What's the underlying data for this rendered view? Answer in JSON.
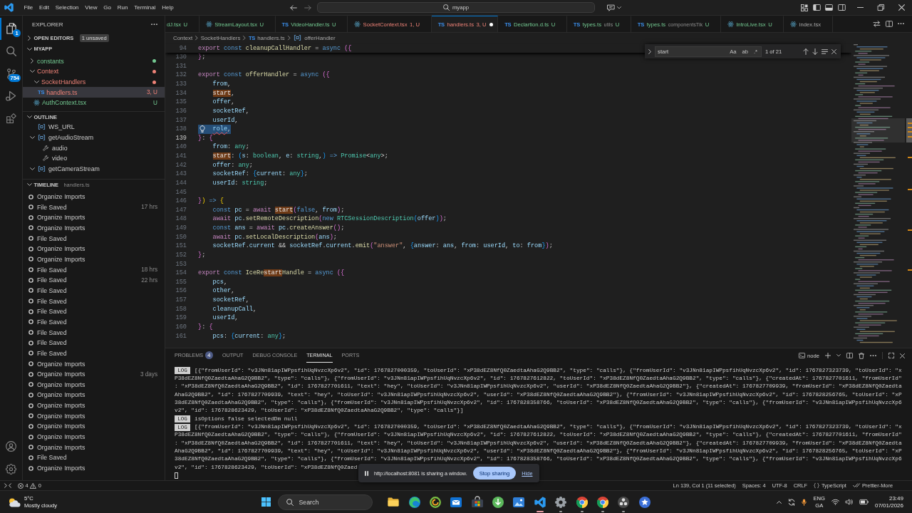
{
  "title_bar": {
    "menu": [
      "File",
      "Edit",
      "Selection",
      "View",
      "Go",
      "Run",
      "Terminal",
      "Help"
    ],
    "command_center": "myapp"
  },
  "activity_bar": {
    "items": [
      {
        "kind": "files",
        "selected": true,
        "badge": "1"
      },
      {
        "kind": "search",
        "selected": false
      },
      {
        "kind": "branch",
        "selected": false,
        "badge": "754"
      },
      {
        "kind": "play",
        "selected": false
      },
      {
        "kind": "blocks",
        "selected": false
      }
    ]
  },
  "sidebar": {
    "title": "EXPLORER",
    "open_editors": {
      "label": "OPEN EDITORS",
      "expanded": false,
      "badge": "1 unsaved"
    },
    "project": {
      "label": "MYAPP",
      "expanded": true,
      "items": [
        {
          "kind": "folder",
          "label": "constants",
          "expanded": false,
          "selected": false,
          "problems": false
        },
        {
          "kind": "folder",
          "label": "Context",
          "expanded": true,
          "selected": false,
          "problems": true,
          "children": [
            {
              "kind": "folder",
              "label": "SocketHandlers",
              "expanded": true,
              "selected": false,
              "problems": true,
              "children": [
                {
                  "kind": "ts",
                  "icon": "TS",
                  "label": "handlers.ts",
                  "status": "3, U",
                  "selected": true,
                  "problems": true
                }
              ]
            },
            {
              "kind": "react",
              "label": "AuthContext.tsx",
              "status": "U",
              "selected": false,
              "problems": false
            }
          ]
        }
      ]
    },
    "outline": {
      "label": "OUTLINE",
      "expanded": true,
      "items": [
        {
          "kind": "symbol",
          "label": "WS_URL"
        },
        {
          "kind": "symbol",
          "label": "getAudioStream",
          "expanded": true,
          "children": [
            {
              "kind": "property",
              "label": "audio"
            },
            {
              "kind": "property",
              "label": "video"
            }
          ]
        },
        {
          "kind": "symbol",
          "label": "getCameraStream",
          "expanded": true
        }
      ]
    },
    "timeline": {
      "label": "TIMELINE",
      "file": "handlers.ts",
      "expanded": true,
      "items": [
        {
          "label": "Organize Imports"
        },
        {
          "label": "File Saved",
          "time": "17 hrs"
        },
        {
          "label": "Organize Imports"
        },
        {
          "label": "Organize Imports"
        },
        {
          "label": "File Saved"
        },
        {
          "label": "Organize Imports"
        },
        {
          "label": "Organize Imports"
        },
        {
          "label": "File Saved",
          "time": "18 hrs"
        },
        {
          "label": "File Saved",
          "time": "22 hrs"
        },
        {
          "label": "File Saved"
        },
        {
          "label": "File Saved"
        },
        {
          "label": "File Saved"
        },
        {
          "label": "File Saved"
        },
        {
          "label": "File Saved"
        },
        {
          "label": "File Saved"
        },
        {
          "label": "File Saved"
        },
        {
          "label": "Organize Imports"
        },
        {
          "label": "Organize Imports",
          "time": "3 days"
        },
        {
          "label": "Organize Imports"
        },
        {
          "label": "Organize Imports"
        },
        {
          "label": "Organize Imports"
        },
        {
          "label": "Organize Imports"
        },
        {
          "label": "Organize Imports"
        },
        {
          "label": "Organize Imports"
        },
        {
          "label": "Organize Imports"
        },
        {
          "label": "File Saved"
        },
        {
          "label": "Organize Imports"
        }
      ]
    }
  },
  "tabs": [
    {
      "label": "dJ.tsx",
      "status": "U",
      "problems": false,
      "selected": false,
      "dirty": false
    },
    {
      "kind": "react",
      "label": "StreamLayout.tsx",
      "status": "U",
      "problems": false,
      "selected": false,
      "dirty": false
    },
    {
      "kind": "ts",
      "icon": "TS",
      "label": "VideoHandler.ts",
      "status": "U",
      "problems": false,
      "selected": false,
      "dirty": false
    },
    {
      "kind": "react",
      "label": "SocketContext.tsx",
      "status": "1, U",
      "problems": true,
      "selected": false,
      "dirty": false
    },
    {
      "kind": "ts",
      "icon": "TS",
      "label": "handlers.ts",
      "status": "3, U",
      "problems": true,
      "selected": true,
      "dirty": true
    },
    {
      "kind": "ts",
      "icon": "TS",
      "label": "Declartion.d.ts",
      "status": "U",
      "problems": false,
      "selected": false,
      "dirty": false
    },
    {
      "kind": "ts",
      "icon": "TS",
      "label": "types.ts",
      "description": "utils",
      "status": "U",
      "problems": false,
      "selected": false,
      "dirty": false
    },
    {
      "kind": "ts",
      "icon": "TS",
      "label": "types.ts",
      "description": "componentsTik",
      "status": "U",
      "problems": false,
      "selected": false,
      "dirty": false
    },
    {
      "kind": "react",
      "label": "IntroLive.tsx",
      "status": "U",
      "problems": false,
      "selected": false,
      "dirty": false
    },
    {
      "kind": "react",
      "label": "index.tsx",
      "problems": false,
      "selected": false,
      "dirty": false
    }
  ],
  "breadcrumbs": [
    {
      "kind": "folder",
      "label": "Context"
    },
    {
      "kind": "folder",
      "label": "SocketHandlers"
    },
    {
      "kind": "ts",
      "icon": "TS",
      "label": "handlers.ts"
    },
    {
      "kind": "symbol",
      "label": "offerHandler"
    }
  ],
  "editor": {
    "sticky": {
      "number": "94",
      "tokens": [
        {
          "kind": "control",
          "text": "export "
        },
        {
          "kind": "keyword",
          "text": "const "
        },
        {
          "kind": "function",
          "text": "cleanupCallHandler"
        },
        {
          "kind": "plain",
          "text": " = "
        },
        {
          "kind": "keyword",
          "text": "async "
        },
        {
          "kind": "bracket2",
          "text": "({"
        }
      ]
    },
    "lines": [
      {
        "number": "130",
        "active": false,
        "selected": false,
        "tokens": [
          {
            "kind": "bracket2",
            "text": "}"
          },
          {
            "kind": "plain",
            "text": ";"
          }
        ]
      },
      {
        "number": "131",
        "active": false,
        "selected": false
      },
      {
        "number": "132",
        "active": false,
        "selected": false,
        "tokens": [
          {
            "kind": "control",
            "text": "export "
          },
          {
            "kind": "keyword",
            "text": "const "
          },
          {
            "kind": "function",
            "text": "offerHandler"
          },
          {
            "kind": "plain",
            "text": " = "
          },
          {
            "kind": "keyword",
            "text": "async "
          },
          {
            "kind": "bracket2",
            "text": "({"
          }
        ]
      },
      {
        "number": "133",
        "active": false,
        "selected": false,
        "tokens": [
          {
            "kind": "variable",
            "text": "    from"
          },
          {
            "kind": "plain",
            "text": ","
          }
        ]
      },
      {
        "number": "134",
        "active": false,
        "selected": false,
        "tokens": [
          {
            "kind": "match",
            "text": "    start"
          },
          {
            "kind": "plain",
            "text": ","
          }
        ]
      },
      {
        "number": "135",
        "active": false,
        "selected": false,
        "tokens": [
          {
            "kind": "variable",
            "text": "    offer"
          },
          {
            "kind": "plain",
            "text": ","
          }
        ]
      },
      {
        "number": "136",
        "active": false,
        "selected": false,
        "tokens": [
          {
            "kind": "variable",
            "text": "    socketRef"
          },
          {
            "kind": "plain",
            "text": ","
          }
        ]
      },
      {
        "number": "137",
        "active": false,
        "selected": false,
        "tokens": [
          {
            "kind": "variable",
            "text": "    userId"
          },
          {
            "kind": "plain",
            "text": ","
          }
        ]
      },
      {
        "number": "138",
        "active": false,
        "selected": true,
        "tokens": [
          {
            "kind": "error",
            "text": "    role"
          },
          {
            "kind": "plain",
            "text": ","
          }
        ]
      },
      {
        "number": "139",
        "active": true,
        "selected": false,
        "tokens": [
          {
            "kind": "bracket2",
            "text": "}"
          },
          {
            "kind": "plain",
            "text": ": "
          },
          {
            "kind": "bracket2",
            "text": "{"
          }
        ]
      },
      {
        "number": "140",
        "active": false,
        "selected": false,
        "tokens": [
          {
            "kind": "variable",
            "text": "    from"
          },
          {
            "kind": "plain",
            "text": ": "
          },
          {
            "kind": "type",
            "text": "any"
          },
          {
            "kind": "plain",
            "text": ";"
          }
        ]
      },
      {
        "number": "141",
        "active": false,
        "selected": false,
        "tokens": [
          {
            "kind": "match",
            "text": "    start"
          },
          {
            "kind": "plain",
            "text": ": "
          },
          {
            "kind": "bracket3",
            "text": "("
          },
          {
            "kind": "variable",
            "text": "s"
          },
          {
            "kind": "plain",
            "text": ": "
          },
          {
            "kind": "type",
            "text": "boolean"
          },
          {
            "kind": "plain",
            "text": ", "
          },
          {
            "kind": "variable",
            "text": "e"
          },
          {
            "kind": "plain",
            "text": ": "
          },
          {
            "kind": "type",
            "text": "string"
          },
          {
            "kind": "plain",
            "text": ","
          },
          {
            "kind": "bracket3",
            "text": ")"
          },
          {
            "kind": "keyword",
            "text": " => "
          },
          {
            "kind": "type",
            "text": "Promise"
          },
          {
            "kind": "plain",
            "text": "<"
          },
          {
            "kind": "type",
            "text": "any"
          },
          {
            "kind": "plain",
            "text": ">;"
          }
        ]
      },
      {
        "number": "142",
        "active": false,
        "selected": false,
        "tokens": [
          {
            "kind": "variable",
            "text": "    offer"
          },
          {
            "kind": "plain",
            "text": ": "
          },
          {
            "kind": "type",
            "text": "any"
          },
          {
            "kind": "plain",
            "text": ";"
          }
        ]
      },
      {
        "number": "143",
        "active": false,
        "selected": false,
        "tokens": [
          {
            "kind": "variable",
            "text": "    socketRef"
          },
          {
            "kind": "plain",
            "text": ": "
          },
          {
            "kind": "bracket3",
            "text": "{"
          },
          {
            "kind": "variable",
            "text": "current"
          },
          {
            "kind": "plain",
            "text": ": "
          },
          {
            "kind": "type",
            "text": "any"
          },
          {
            "kind": "bracket3",
            "text": "}"
          },
          {
            "kind": "plain",
            "text": ";"
          }
        ]
      },
      {
        "number": "144",
        "active": false,
        "selected": false,
        "tokens": [
          {
            "kind": "variable",
            "text": "    userId"
          },
          {
            "kind": "plain",
            "text": ": "
          },
          {
            "kind": "type",
            "text": "string"
          },
          {
            "kind": "plain",
            "text": ";"
          }
        ]
      },
      {
        "number": "145",
        "active": false,
        "selected": false
      },
      {
        "number": "146",
        "active": false,
        "selected": false,
        "tokens": [
          {
            "kind": "bracket2",
            "text": "}"
          },
          {
            "kind": "bracket1",
            "text": ")"
          },
          {
            "kind": "keyword",
            "text": " => "
          },
          {
            "kind": "bracket1",
            "text": "{"
          }
        ]
      },
      {
        "number": "147",
        "active": false,
        "selected": false,
        "tokens": [
          {
            "kind": "keyword",
            "text": "    const "
          },
          {
            "kind": "variable",
            "text": "pc"
          },
          {
            "kind": "plain",
            "text": " = "
          },
          {
            "kind": "control",
            "text": "await "
          },
          {
            "kind": "match",
            "text": "start"
          },
          {
            "kind": "bracket2",
            "text": "("
          },
          {
            "kind": "keyword",
            "text": "false"
          },
          {
            "kind": "plain",
            "text": ", "
          },
          {
            "kind": "variable",
            "text": "from"
          },
          {
            "kind": "bracket2",
            "text": ")"
          },
          {
            "kind": "plain",
            "text": ";"
          }
        ]
      },
      {
        "number": "148",
        "active": false,
        "selected": false,
        "tokens": [
          {
            "kind": "control",
            "text": "    await "
          },
          {
            "kind": "variable",
            "text": "pc"
          },
          {
            "kind": "plain",
            "text": "."
          },
          {
            "kind": "function",
            "text": "setRemoteDescription"
          },
          {
            "kind": "bracket2",
            "text": "("
          },
          {
            "kind": "keyword",
            "text": "new "
          },
          {
            "kind": "type",
            "text": "RTCSessionDescription"
          },
          {
            "kind": "bracket3",
            "text": "("
          },
          {
            "kind": "variable",
            "text": "offer"
          },
          {
            "kind": "bracket3",
            "text": ")"
          },
          {
            "kind": "bracket2",
            "text": ")"
          },
          {
            "kind": "plain",
            "text": ";"
          }
        ]
      },
      {
        "number": "149",
        "active": false,
        "selected": false,
        "tokens": [
          {
            "kind": "keyword",
            "text": "    const "
          },
          {
            "kind": "variable",
            "text": "ans"
          },
          {
            "kind": "plain",
            "text": " = "
          },
          {
            "kind": "control",
            "text": "await "
          },
          {
            "kind": "variable",
            "text": "pc"
          },
          {
            "kind": "plain",
            "text": "."
          },
          {
            "kind": "function",
            "text": "createAnswer"
          },
          {
            "kind": "bracket2",
            "text": "()"
          },
          {
            "kind": "plain",
            "text": ";"
          }
        ]
      },
      {
        "number": "150",
        "active": false,
        "selected": false,
        "tokens": [
          {
            "kind": "control",
            "text": "    await "
          },
          {
            "kind": "variable",
            "text": "pc"
          },
          {
            "kind": "plain",
            "text": "."
          },
          {
            "kind": "function",
            "text": "setLocalDescription"
          },
          {
            "kind": "bracket2",
            "text": "("
          },
          {
            "kind": "variable",
            "text": "ans"
          },
          {
            "kind": "bracket2",
            "text": ")"
          },
          {
            "kind": "plain",
            "text": ";"
          }
        ]
      },
      {
        "number": "151",
        "active": false,
        "selected": false,
        "tokens": [
          {
            "kind": "variable",
            "text": "    socketRef"
          },
          {
            "kind": "plain",
            "text": "."
          },
          {
            "kind": "variable",
            "text": "current"
          },
          {
            "kind": "plain",
            "text": " && "
          },
          {
            "kind": "variable",
            "text": "socketRef"
          },
          {
            "kind": "plain",
            "text": "."
          },
          {
            "kind": "variable",
            "text": "current"
          },
          {
            "kind": "plain",
            "text": "."
          },
          {
            "kind": "function",
            "text": "emit"
          },
          {
            "kind": "bracket2",
            "text": "("
          },
          {
            "kind": "string",
            "text": "\"answer\""
          },
          {
            "kind": "plain",
            "text": ", "
          },
          {
            "kind": "bracket3",
            "text": "{"
          },
          {
            "kind": "variable",
            "text": "answer"
          },
          {
            "kind": "plain",
            "text": ": "
          },
          {
            "kind": "variable",
            "text": "ans"
          },
          {
            "kind": "plain",
            "text": ", "
          },
          {
            "kind": "variable",
            "text": "from"
          },
          {
            "kind": "plain",
            "text": ": "
          },
          {
            "kind": "variable",
            "text": "userId"
          },
          {
            "kind": "plain",
            "text": ", "
          },
          {
            "kind": "variable",
            "text": "to"
          },
          {
            "kind": "plain",
            "text": ": "
          },
          {
            "kind": "variable",
            "text": "from"
          },
          {
            "kind": "bracket3",
            "text": "}"
          },
          {
            "kind": "bracket2",
            "text": ")"
          },
          {
            "kind": "plain",
            "text": ";"
          }
        ]
      },
      {
        "number": "152",
        "active": false,
        "selected": false,
        "tokens": [
          {
            "kind": "bracket2",
            "text": "}"
          },
          {
            "kind": "plain",
            "text": ";"
          }
        ]
      },
      {
        "number": "153",
        "active": false,
        "selected": false
      },
      {
        "number": "154",
        "active": false,
        "selected": false,
        "tokens": [
          {
            "kind": "control",
            "text": "export "
          },
          {
            "kind": "keyword",
            "text": "const "
          },
          {
            "kind": "function",
            "text": "IceRe"
          },
          {
            "kind": "match",
            "text": "start"
          },
          {
            "kind": "function",
            "text": "Handle"
          },
          {
            "kind": "plain",
            "text": " = "
          },
          {
            "kind": "keyword",
            "text": "async "
          },
          {
            "kind": "bracket2",
            "text": "({"
          }
        ]
      },
      {
        "number": "155",
        "active": false,
        "selected": false,
        "tokens": [
          {
            "kind": "variable",
            "text": "    pcs"
          },
          {
            "kind": "plain",
            "text": ","
          }
        ]
      },
      {
        "number": "156",
        "active": false,
        "selected": false,
        "tokens": [
          {
            "kind": "variable",
            "text": "    other"
          },
          {
            "kind": "plain",
            "text": ","
          }
        ]
      },
      {
        "number": "157",
        "active": false,
        "selected": false,
        "tokens": [
          {
            "kind": "variable",
            "text": "    socketRef"
          },
          {
            "kind": "plain",
            "text": ","
          }
        ]
      },
      {
        "number": "158",
        "active": false,
        "selected": false,
        "tokens": [
          {
            "kind": "variable",
            "text": "    cleanupCall"
          },
          {
            "kind": "plain",
            "text": ","
          }
        ]
      },
      {
        "number": "159",
        "active": false,
        "selected": false,
        "tokens": [
          {
            "kind": "variable",
            "text": "    userId"
          },
          {
            "kind": "plain",
            "text": ","
          }
        ]
      },
      {
        "number": "160",
        "active": false,
        "selected": false,
        "tokens": [
          {
            "kind": "bracket2",
            "text": "}"
          },
          {
            "kind": "plain",
            "text": ": "
          },
          {
            "kind": "bracket2",
            "text": "{"
          }
        ]
      },
      {
        "number": "161",
        "active": false,
        "selected": false,
        "tokens": [
          {
            "kind": "variable",
            "text": "    pcs"
          },
          {
            "kind": "plain",
            "text": ": "
          },
          {
            "kind": "bracket3",
            "text": "{"
          },
          {
            "kind": "variable",
            "text": "current"
          },
          {
            "kind": "plain",
            "text": ": "
          },
          {
            "kind": "type",
            "text": "any"
          },
          {
            "kind": "bracket3",
            "text": "}"
          },
          {
            "kind": "plain",
            "text": ";"
          }
        ]
      }
    ]
  },
  "find": {
    "value": "start",
    "options": [
      {
        "label": "Aa",
        "selected": false
      },
      {
        "label": "ab",
        "selected": false
      },
      {
        "label": ".*",
        "selected": false
      }
    ],
    "count": "1 of 21"
  },
  "panel": {
    "tabs": [
      {
        "label": "PROBLEMS",
        "badge": "4",
        "selected": false
      },
      {
        "label": "OUTPUT",
        "selected": false
      },
      {
        "label": "DEBUG CONSOLE",
        "selected": false
      },
      {
        "label": "TERMINAL",
        "selected": true
      },
      {
        "label": "PORTS",
        "selected": false
      }
    ],
    "profile": "node",
    "terminal": [
      {
        "badge": "LOG",
        "lines": [
          "[{\"fromUserId\": \"v3JNn81apIWPpsfihUqNvzcXp6v2\", \"id\": 1767827000359, \"toUserId\": \"xP38dEZ8NfQ0ZaedtaAhaG2Q9BB2\", \"type\": \"calls\"}, {\"fromUserId\": \"v3JNn81apIWPpsfihUqNvzcXp6v2\", \"id\": 1767827323739, \"toUserId\": \"x",
          "P38dEZ8NfQ0ZaedtaAhaG2Q9BB2\", \"type\": \"calls\"}, {\"fromUserId\": \"v3JNn81apIWPpsfihUqNvzcXp6v2\", \"id\": 1767827612822, \"toUserId\": \"xP38dEZ8NfQ0ZaedtaAhaG2Q9BB2\", \"type\": \"calls\"}, {\"createdAt\": 1767827701611, \"fromUserId\"",
          ": \"xP38dEZ8NfQ0ZaedtaAhaG2Q9BB2\", \"id\": 1767827701611, \"text\": \"hey\", \"toUserId\": \"v3JNn81apIWPpsfihUqNvzcXp6v2\", \"userId\": \"xP38dEZ8NfQ0ZaedtaAhaG2Q9BB2\"}, {\"createdAt\": 1767827709939, \"fromUserId\": \"xP38dEZ8NfQ0Zaedta",
          "AhaG2Q9BB2\", \"id\": 1767827709939, \"text\": \"hey\", \"toUserId\": \"v3JNn81apIWPpsfihUqNvzcXp6v2\", \"userId\": \"xP38dEZ8NfQ0ZaedtaAhaG2Q9BB2\"}, {\"fromUserId\": \"v3JNn81apIWPpsfihUqNvzcXp6v2\", \"id\": 1767828256765, \"toUserId\": \"xP",
          "38dEZ8NfQ0ZaedtaAhaG2Q9BB2\", \"type\": \"calls\"}, {\"fromUserId\": \"v3JNn81apIWPpsfihUqNvzcXp6v2\", \"id\": 1767828358766, \"toUserId\": \"xP38dEZ8NfQ0ZaedtaAhaG2Q9BB2\", \"type\": \"calls\"}, {\"fromUserId\": \"v3JNn81apIWPpsfihUqNvzcXp6",
          "v2\", \"id\": 1767828623429, \"toUserId\": \"xP38dEZ8NfQ0ZaedtaAhaG2Q9BB2\", \"type\": \"calls\"}]"
        ]
      },
      {
        "badge": "LOG",
        "lines": [
          "isOptions false selectedDm null"
        ]
      },
      {
        "badge": "LOG",
        "lines": [
          "[{\"fromUserId\": \"v3JNn81apIWPpsfihUqNvzcXp6v2\", \"id\": 1767827000359, \"toUserId\": \"xP38dEZ8NfQ0ZaedtaAhaG2Q9BB2\", \"type\": \"calls\"}, {\"fromUserId\": \"v3JNn81apIWPpsfihUqNvzcXp6v2\", \"id\": 1767827323739, \"toUserId\": \"x",
          "P38dEZ8NfQ0ZaedtaAhaG2Q9BB2\", \"type\": \"calls\"}, {\"fromUserId\": \"v3JNn81apIWPpsfihUqNvzcXp6v2\", \"id\": 1767827612822, \"toUserId\": \"xP38dEZ8NfQ0ZaedtaAhaG2Q9BB2\", \"type\": \"calls\"}, {\"createdAt\": 1767827701611, \"fromUserId\"",
          ": \"xP38dEZ8NfQ0ZaedtaAhaG2Q9BB2\", \"id\": 1767827701611, \"text\": \"hey\", \"toUserId\": \"v3JNn81apIWPpsfihUqNvzcXp6v2\", \"userId\": \"xP38dEZ8NfQ0ZaedtaAhaG2Q9BB2\"}, {\"createdAt\": 1767827709939, \"fromUserId\": \"xP38dEZ8NfQ0Zaedta",
          "AhaG2Q9BB2\", \"id\": 1767827709939, \"text\": \"hey\", \"toUserId\": \"v3JNn81apIWPpsfihUqNvzcXp6v2\", \"userId\": \"xP38dEZ8NfQ0ZaedtaAhaG2Q9BB2\"}, {\"fromUserId\": \"v3JNn81apIWPpsfihUqNvzcXp6v2\", \"id\": 1767828256765, \"toUserId\": \"xP",
          "38dEZ8NfQ0ZaedtaAhaG2Q9BB2\", \"type\": \"calls\"}, {\"fromUserId\": \"v3JNn81apIWPpsfihUqNvzcXp6v2\", \"id\": 1767828358766, \"toUserId\": \"xP38dEZ8NfQ0ZaedtaAhaG2Q9BB2\", \"type\": \"calls\"}, {\"fromUserId\": \"v3JNn81apIWPpsfihUqNvzcXp6",
          "v2\", \"id\": 1767828623429, \"toUserId\": \"xP38dEZ8NfQ0Zaed"
        ]
      }
    ]
  },
  "share_bar": {
    "message": "http://localhost:8081 is sharing a window.",
    "stop": "Stop sharing",
    "hide": "Hide"
  },
  "status_bar": {
    "errors": "4",
    "warnings": "0",
    "items": [
      "Ln 139, Col 1 (11 selected)",
      "Spaces: 4",
      "UTF-8",
      "CRLF"
    ],
    "language": "TypeScript",
    "formatter": "Prettier-More"
  },
  "taskbar": {
    "weather": {
      "temperature": "5°C",
      "condition": "Mostly cloudy"
    },
    "search": "Search",
    "apps": [
      {
        "kind": "folder",
        "selected": false,
        "running": false
      },
      {
        "kind": "wave",
        "selected": false,
        "running": false
      },
      {
        "kind": "swirl",
        "selected": false,
        "running": false
      },
      {
        "kind": "envelope",
        "selected": false,
        "running": false
      },
      {
        "kind": "bag",
        "selected": false,
        "running": false
      },
      {
        "kind": "download",
        "selected": false,
        "running": false
      },
      {
        "kind": "picture",
        "selected": false,
        "running": false
      },
      {
        "kind": "ribbon",
        "selected": true,
        "running": true
      },
      {
        "kind": "gear",
        "selected": false,
        "running": true
      },
      {
        "kind": "wheel",
        "selected": false,
        "running": true
      },
      {
        "kind": "wheel",
        "selected": false,
        "running": true
      },
      {
        "kind": "aperture",
        "selected": false,
        "running": true
      },
      {
        "kind": "star",
        "selected": false,
        "running": false
      }
    ],
    "tray": {
      "language": "ENG",
      "layout": "GA",
      "time": "23:49",
      "date": "07/01/2026"
    }
  }
}
